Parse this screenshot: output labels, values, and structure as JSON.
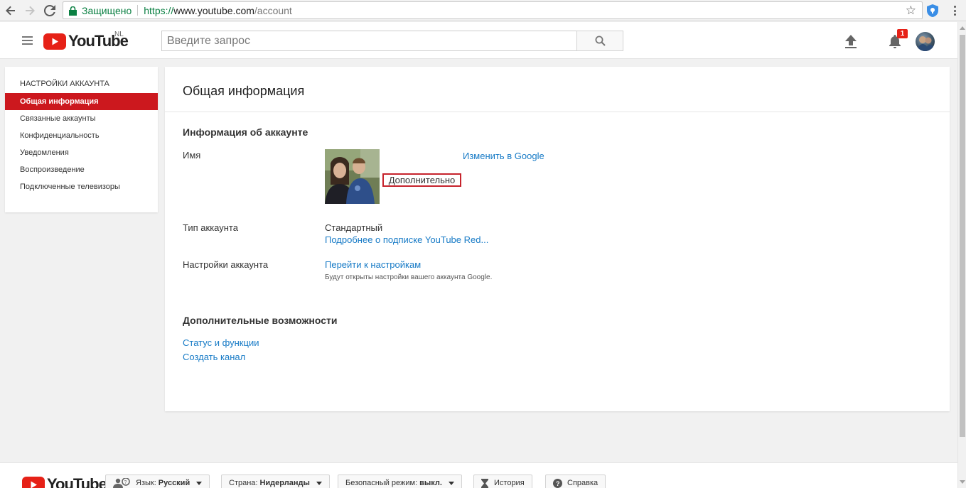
{
  "browser": {
    "secure_label": "Защищено",
    "url_scheme": "https://",
    "url_host": "www.youtube.com",
    "url_path": "/account"
  },
  "header": {
    "logo_text": "YouTube",
    "region": "NL",
    "search_placeholder": "Введите запрос",
    "notification_count": "1"
  },
  "sidebar": {
    "title": "НАСТРОЙКИ АККАУНТА",
    "items": [
      {
        "label": "Общая информация",
        "active": true
      },
      {
        "label": "Связанные аккаунты"
      },
      {
        "label": "Конфиденциальность"
      },
      {
        "label": "Уведомления"
      },
      {
        "label": "Воспроизведение"
      },
      {
        "label": "Подключенные телевизоры"
      }
    ]
  },
  "main": {
    "title": "Общая информация",
    "account_info_heading": "Информация об аккаунте",
    "name_label": "Имя",
    "edit_in_google": "Изменить в Google",
    "more_link": "Дополнительно",
    "account_type_label": "Тип аккаунта",
    "account_type_value": "Стандартный",
    "red_link": "Подробнее о подписке YouTube Red...",
    "account_settings_label": "Настройки аккаунта",
    "goto_settings": "Перейти к настройкам",
    "settings_note": "Будут открыты настройки вашего аккаунта Google.",
    "extra_heading": "Дополнительные возможности",
    "status_link": "Статус и функции",
    "create_channel": "Создать канал"
  },
  "footer": {
    "logo_text": "YouTube",
    "language_label": "Язык:",
    "language_value": "Русский",
    "country_label": "Страна:",
    "country_value": "Нидерланды",
    "safety_label": "Безопасный режим:",
    "safety_value": "выкл.",
    "history": "История",
    "help": "Справка"
  },
  "colors": {
    "brand_red": "#cc181e",
    "link_blue": "#167ac6",
    "highlight_box": "#c6232c"
  }
}
